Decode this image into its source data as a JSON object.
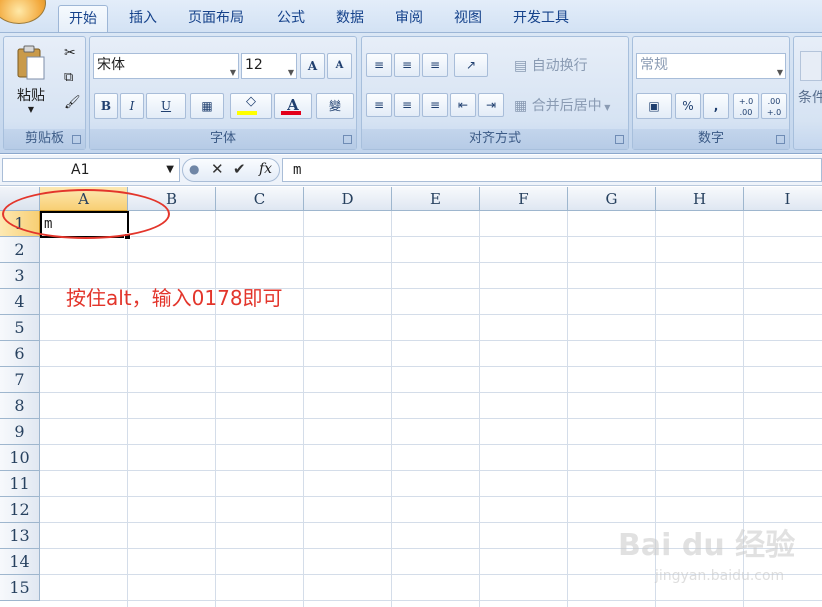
{
  "tabs": [
    "开始",
    "插入",
    "页面布局",
    "公式",
    "数据",
    "审阅",
    "视图",
    "开发工具"
  ],
  "clipboard": {
    "paste_label": "粘贴",
    "group_label": "剪贴板"
  },
  "font": {
    "family": "宋体",
    "size": "12",
    "bold": "B",
    "italic": "I",
    "underline": "U",
    "font_color_glyph": "A",
    "grow_glyph": "A",
    "shrink_glyph": "A",
    "phonetic_glyph": "變",
    "group_label": "字体"
  },
  "alignment": {
    "wrap_label": "自动换行",
    "merge_label": "合并后居中",
    "group_label": "对齐方式"
  },
  "number": {
    "format": "常规",
    "percent": "%",
    "comma": ",",
    "inc_dec": "+.0 .00",
    "dec_dec": ".00 +.0",
    "group_label": "数字"
  },
  "styles": {
    "cond_label": "条件"
  },
  "formula_bar": {
    "name_box": "A1",
    "fx": "fx",
    "content": "m"
  },
  "columns": [
    "A",
    "B",
    "C",
    "D",
    "E",
    "F",
    "G",
    "H",
    "I"
  ],
  "rows": [
    "1",
    "2",
    "3",
    "4",
    "5",
    "6",
    "7",
    "8",
    "9",
    "10",
    "11",
    "12",
    "13",
    "14",
    "15"
  ],
  "cells": {
    "A1": "m"
  },
  "annotation": "按住alt，输入0178即可",
  "watermark": {
    "text": "Bai du 经验",
    "url": "jingyan.baidu.com"
  },
  "colors": {
    "accent_red": "#e3352b",
    "ribbon_blue": "#c9daef",
    "selected_header": "#f8cf74"
  }
}
